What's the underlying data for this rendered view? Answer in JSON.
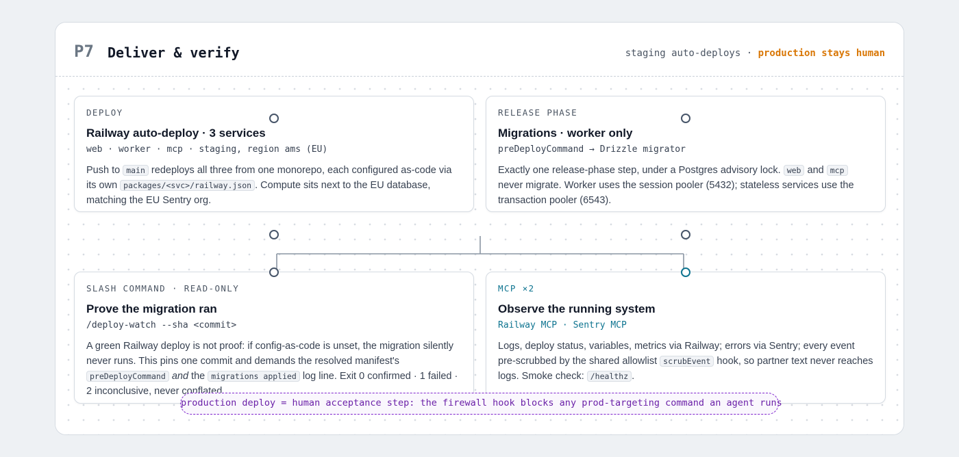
{
  "header": {
    "phase_code": "P7",
    "title": "Deliver & verify",
    "note_plain": "staging auto-deploys",
    "note_sep": " · ",
    "note_strong": "production stays human"
  },
  "cards": {
    "deploy": {
      "kicker": "DEPLOY",
      "title": "Railway auto-deploy · 3 services",
      "sub": "web · worker · mcp · staging, region ams (EU)",
      "body_1": "Push to ",
      "code_1": "main",
      "body_2": " redeploys all three from one monorepo, each configured as-code via its own ",
      "code_2": "packages/<svc>/railway.json",
      "body_3": ". Compute sits next to the EU database, matching the EU Sentry org."
    },
    "release": {
      "kicker": "RELEASE PHASE",
      "title": "Migrations · worker only",
      "sub": "preDeployCommand → Drizzle migrator",
      "body_1": "Exactly one release-phase step, under a Postgres advisory lock. ",
      "code_1": "web",
      "body_2": " and ",
      "code_2": "mcp",
      "body_3": " never migrate. Worker uses the session pooler (5432); stateless services use the transaction pooler (6543)."
    },
    "slash": {
      "kicker": "SLASH COMMAND · READ-ONLY",
      "title": "Prove the migration ran",
      "sub": "/deploy-watch --sha <commit>",
      "body_1": "A green Railway deploy is not proof: if config-as-code is unset, the migration silently never runs. This pins one commit and demands the resolved manifest's ",
      "code_1": "preDeployCommand",
      "body_em": "and",
      "body_2": " the ",
      "code_2": "migrations applied",
      "body_3": " log line. Exit 0 confirmed · 1 failed · 2 inconclusive, never conflated."
    },
    "mcp": {
      "kicker": "MCP ×2",
      "title": "Observe the running system",
      "sub": "Railway MCP · Sentry MCP",
      "body_1": "Logs, deploy status, variables, metrics via Railway; errors via Sentry; every event pre-scrubbed by the shared allowlist ",
      "code_1": "scrubEvent",
      "body_2": " hook, so partner text never reaches logs. Smoke check: ",
      "code_2": "/healthz",
      "body_3": "."
    }
  },
  "footnote": "production deploy = human acceptance step: the firewall hook blocks any prod-targeting command an agent runs",
  "colors": {
    "accent_orange": "#d97706",
    "accent_cyan": "#0e7490",
    "accent_purple": "#7e22ce",
    "node_slate": "#475569"
  }
}
